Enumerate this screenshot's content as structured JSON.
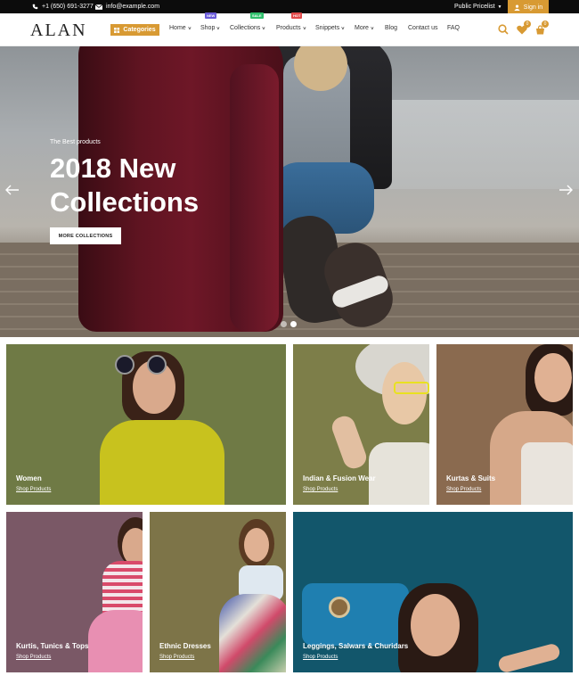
{
  "topbar": {
    "phone": "+1 (650) 691-3277",
    "email": "info@example.com",
    "pricelist": "Public Pricelist",
    "signin": "Sign in"
  },
  "header": {
    "logo": "ALAN",
    "categories": "Categories",
    "nav": [
      {
        "label": "Home",
        "dropdown": true
      },
      {
        "label": "Shop",
        "dropdown": true,
        "badge": "NEW"
      },
      {
        "label": "Collections",
        "dropdown": true,
        "badge": "SALE"
      },
      {
        "label": "Products",
        "dropdown": true,
        "badge": "HOT"
      },
      {
        "label": "Snippets",
        "dropdown": true
      },
      {
        "label": "More",
        "dropdown": true
      },
      {
        "label": "Blog"
      },
      {
        "label": "Contact us"
      },
      {
        "label": "FAQ"
      }
    ],
    "wishlist_count": "0",
    "cart_count": "0",
    "icons": [
      "search-icon",
      "heart-icon",
      "cart-icon"
    ]
  },
  "hero": {
    "tag": "The Best products",
    "title": "2018 New Collections",
    "button": "MORE COLLECTIONS",
    "slides": 2,
    "active_slide": 2
  },
  "tiles": [
    {
      "title": "Women",
      "link": "Shop Products",
      "color": "#6f7a45"
    },
    {
      "title": "Indian & Fusion Wear",
      "link": "Shop Products",
      "color": "#7d7e49"
    },
    {
      "title": "Kurtas & Suits",
      "link": "Shop Products",
      "color": "#8a6a4f"
    },
    {
      "title": "Kurtis, Tunics & Tops",
      "link": "Shop Products",
      "color": "#7a5866"
    },
    {
      "title": "Ethnic Dresses",
      "link": "Shop Products",
      "color": "#7d7448"
    },
    {
      "title": "Leggings, Salwars & Churidars",
      "link": "Shop Products",
      "color": "#12566b"
    }
  ],
  "colors": {
    "accent": "#d89a33",
    "topbar": "#0c0c0c"
  }
}
